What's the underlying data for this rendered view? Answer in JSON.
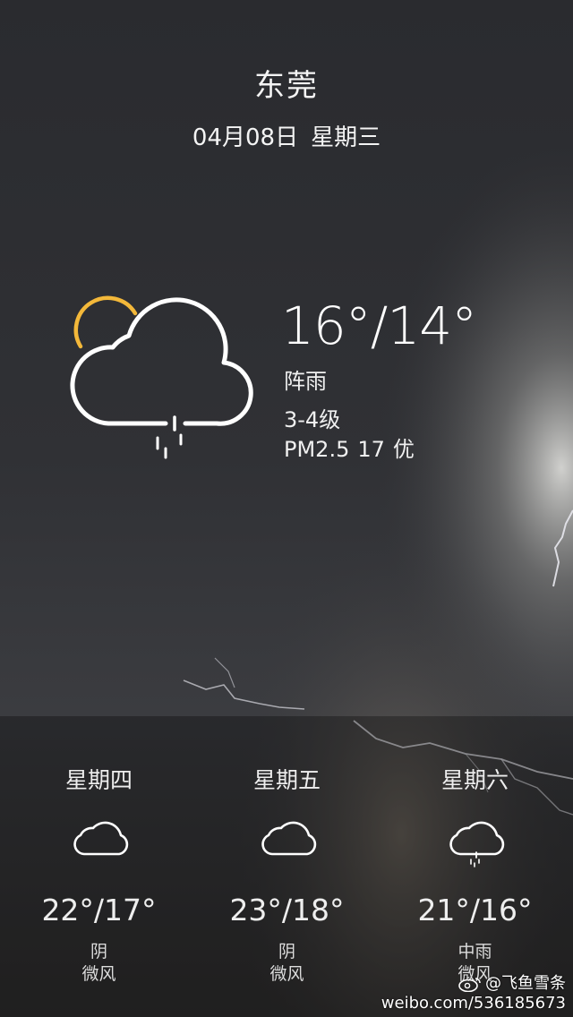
{
  "header": {
    "city": "东莞",
    "date": "04月08日",
    "weekday": "星期三"
  },
  "current": {
    "temperature": "16°/14°",
    "condition": "阵雨",
    "wind": "3-4级",
    "aqi_label": "PM2.5",
    "aqi_value": "17",
    "aqi_level": "优",
    "icon": "partly-sunny-rain-icon"
  },
  "forecast": [
    {
      "day": "星期四",
      "temps": "22°/17°",
      "condition": "阴",
      "wind": "微风",
      "icon": "cloud-icon"
    },
    {
      "day": "星期五",
      "temps": "23°/18°",
      "condition": "阴",
      "wind": "微风",
      "icon": "cloud-icon"
    },
    {
      "day": "星期六",
      "temps": "21°/16°",
      "condition": "中雨",
      "wind": "微风",
      "icon": "cloud-rain-icon"
    }
  ],
  "watermark": {
    "handle": "@飞鱼雪条",
    "url": "weibo.com/5361856​73"
  },
  "colors": {
    "sun_accent": "#f3b83a",
    "text": "#ffffff"
  }
}
